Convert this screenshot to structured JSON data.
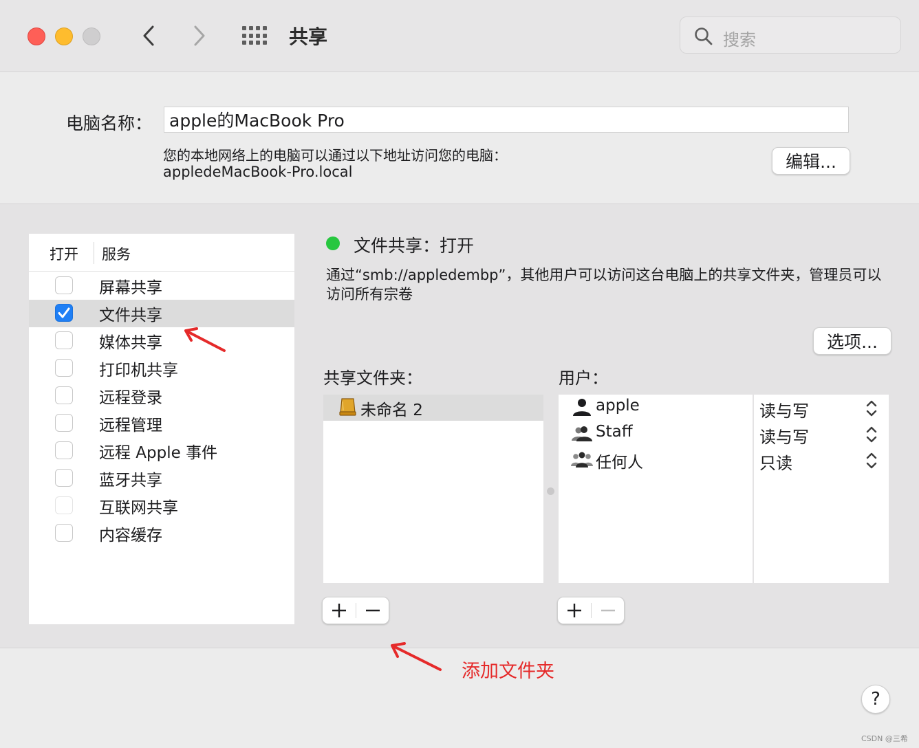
{
  "window": {
    "title": "共享",
    "search_placeholder": "搜索"
  },
  "computer_name": {
    "label": "电脑名称：",
    "value": "apple的MacBook Pro",
    "address_desc": "您的本地网络上的电脑可以通过以下地址访问您的电脑：",
    "address_host": "appledeMacBook-Pro.local",
    "edit_label": "编辑..."
  },
  "services": {
    "header_on": "打开",
    "header_service": "服务",
    "items": [
      {
        "label": "屏幕共享",
        "checked": false
      },
      {
        "label": "文件共享",
        "checked": true
      },
      {
        "label": "媒体共享",
        "checked": false
      },
      {
        "label": "打印机共享",
        "checked": false
      },
      {
        "label": "远程登录",
        "checked": false
      },
      {
        "label": "远程管理",
        "checked": false
      },
      {
        "label": "远程 Apple 事件",
        "checked": false
      },
      {
        "label": "蓝牙共享",
        "checked": false
      },
      {
        "label": "互联网共享",
        "checked": false
      },
      {
        "label": "内容缓存",
        "checked": false
      }
    ]
  },
  "detail": {
    "status": "文件共享：打开",
    "status_color": "#27c73f",
    "description": "通过“smb://appledembp”，其他用户可以访问这台电脑上的共享文件夹，管理员可以访问所有宗卷",
    "options_label": "选项...",
    "folders_label": "共享文件夹：",
    "users_label": "用户：",
    "folders": [
      {
        "name": "未命名 2",
        "icon": "drive-icon"
      }
    ],
    "users": [
      {
        "name": "apple",
        "permission": "读与写",
        "icon": "user-icon"
      },
      {
        "name": "Staff",
        "permission": "读与写",
        "icon": "group-icon"
      },
      {
        "name": "任何人",
        "permission": "只读",
        "icon": "everyone-icon"
      }
    ],
    "plus": "+",
    "minus": "−"
  },
  "annotation": {
    "text": "添加文件夹",
    "color": "#e52a2a"
  },
  "help_label": "?",
  "watermark": "CSDN @三希"
}
